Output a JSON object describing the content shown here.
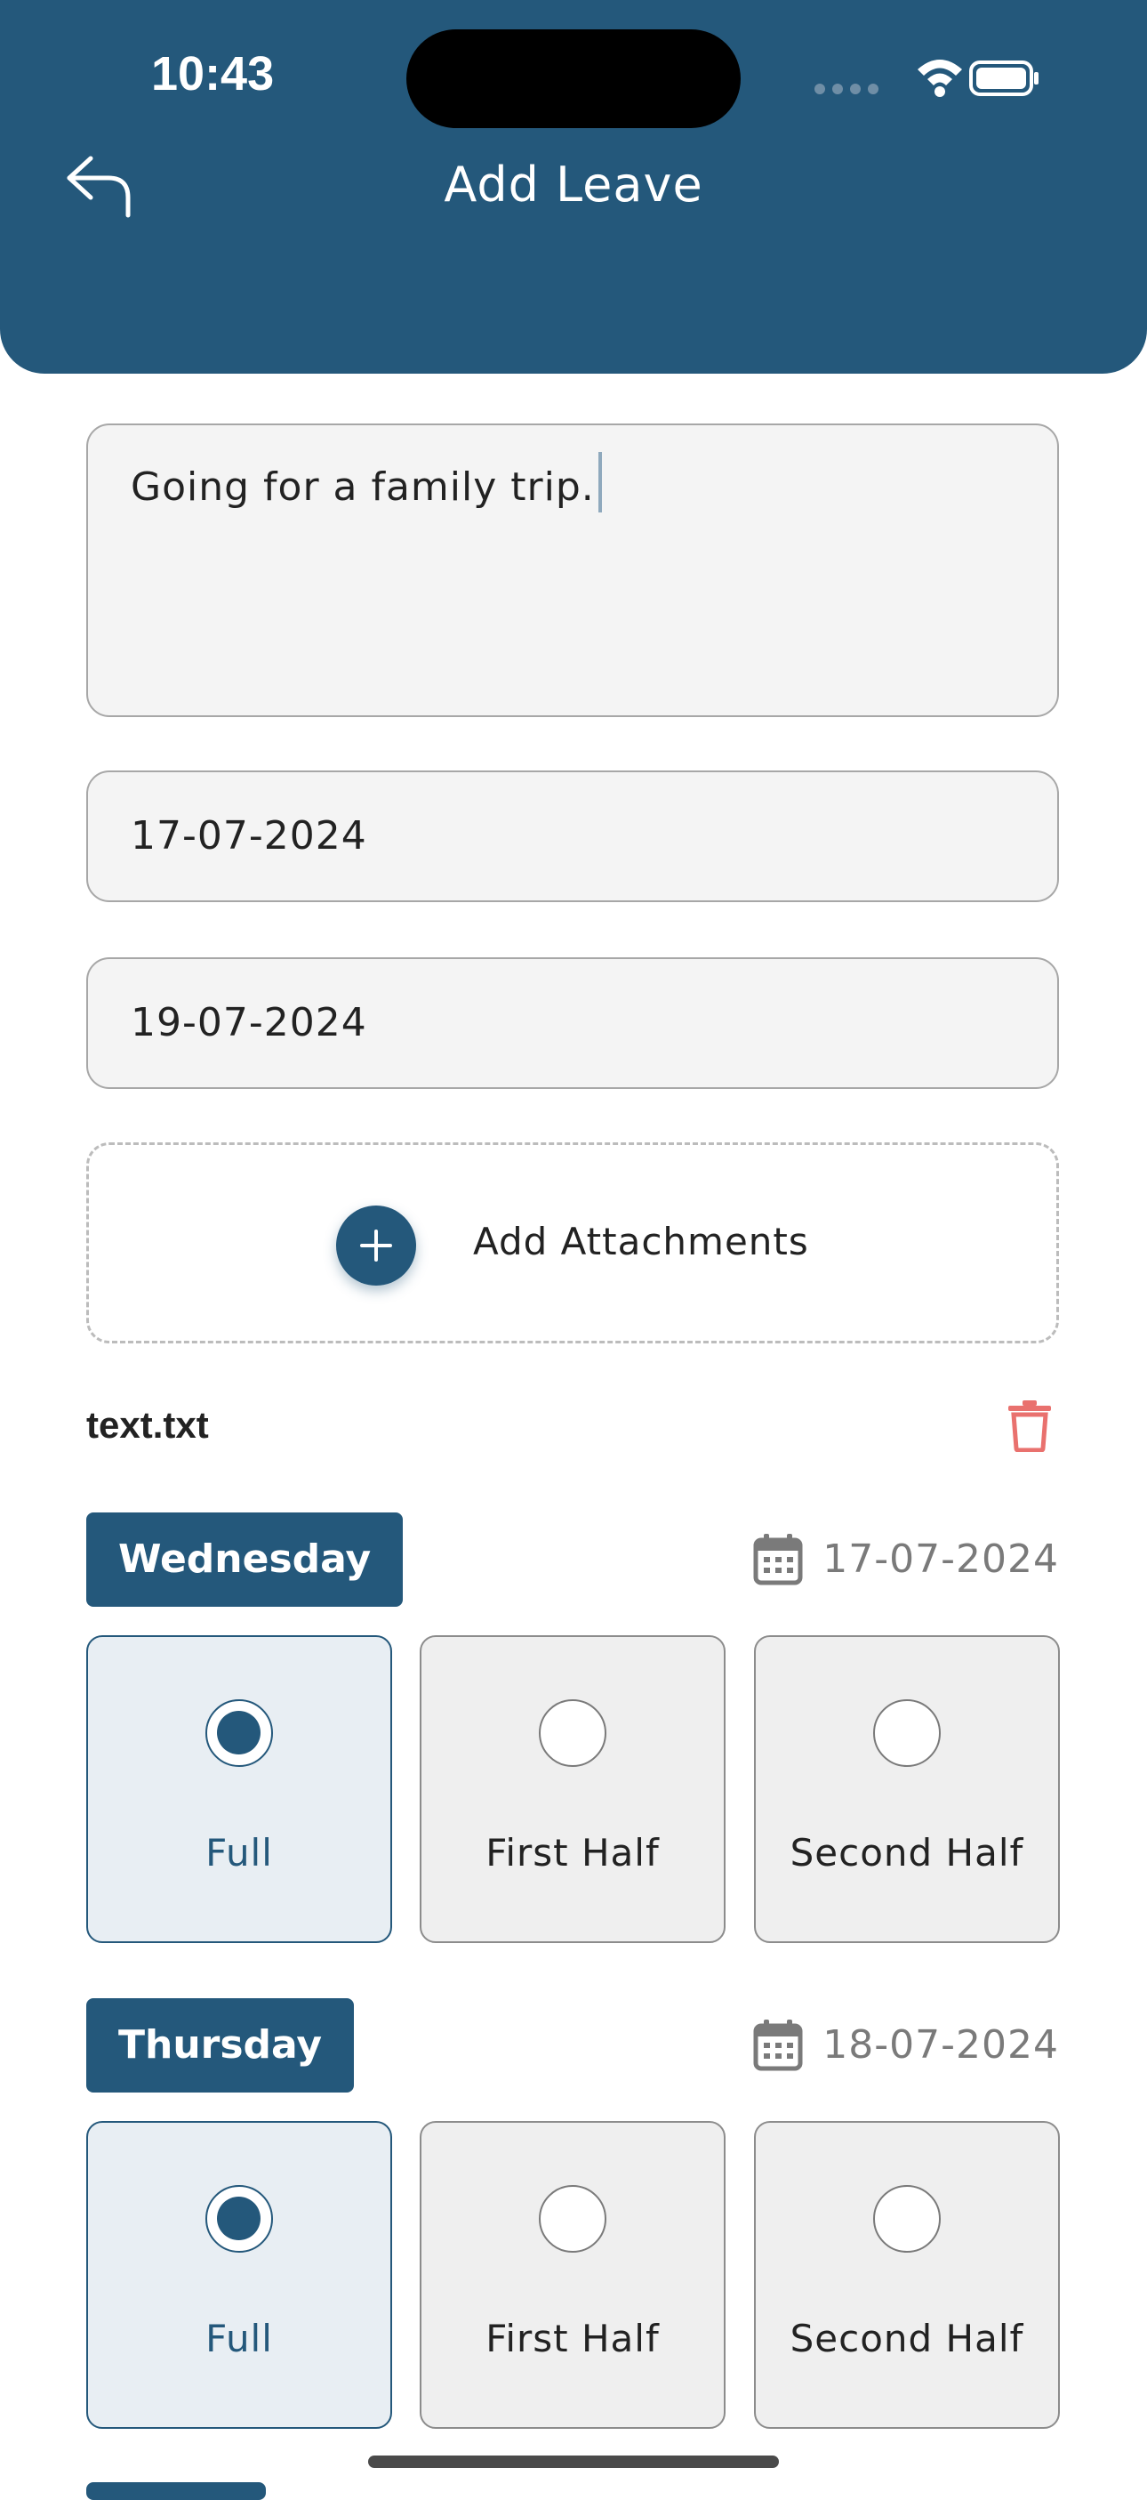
{
  "status_bar": {
    "time": "10:43"
  },
  "header": {
    "title": "Add Leave"
  },
  "form": {
    "reason": "Going for a family trip.",
    "from_date": "17-07-2024",
    "to_date": "19-07-2024",
    "attach_label": "Add Attachments"
  },
  "attachments": [
    {
      "name": "text.txt"
    }
  ],
  "days": [
    {
      "day": "Wednesday",
      "date": "17-07-2024",
      "options": [
        "Full",
        "First Half",
        "Second Half"
      ],
      "selected": "Full"
    },
    {
      "day": "Thursday",
      "date": "18-07-2024",
      "options": [
        "Full",
        "First Half",
        "Second Half"
      ],
      "selected": "Full"
    }
  ],
  "colors": {
    "primary": "#24587b",
    "delete": "#e9716e",
    "field_bg": "#f4f4f4"
  }
}
